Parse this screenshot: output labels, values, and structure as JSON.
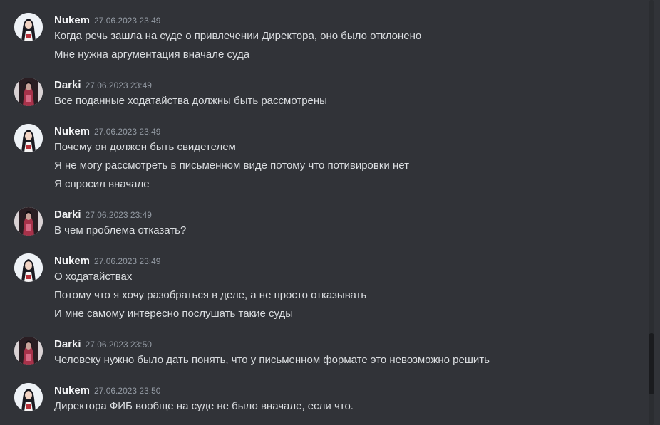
{
  "messages": [
    {
      "author": "Nukem",
      "avatar_icon": "nukem-avatar-icon",
      "time": "27.06.2023 23:49",
      "lines": [
        "Когда речь зашла на суде о привлечении Директора, оно было отклонено",
        "Мне нужна аргументация вначале суда"
      ]
    },
    {
      "author": "Darki",
      "avatar_icon": "darki-avatar-icon",
      "time": "27.06.2023 23:49",
      "lines": [
        "Все поданные ходатайства должны быть рассмотрены"
      ]
    },
    {
      "author": "Nukem",
      "avatar_icon": "nukem-avatar-icon",
      "time": "27.06.2023 23:49",
      "lines": [
        "Почему он должен быть свидетелем",
        "Я не могу рассмотреть в письменном виде потому что потивировки нет",
        "Я спросил вначале"
      ]
    },
    {
      "author": "Darki",
      "avatar_icon": "darki-avatar-icon",
      "time": "27.06.2023 23:49",
      "lines": [
        "В чем проблема отказать?"
      ]
    },
    {
      "author": "Nukem",
      "avatar_icon": "nukem-avatar-icon",
      "time": "27.06.2023 23:49",
      "lines": [
        "О ходатайствах",
        "Потому что я хочу разобраться в деле, а не просто отказывать",
        "И мне самому интересно послушать такие суды"
      ]
    },
    {
      "author": "Darki",
      "avatar_icon": "darki-avatar-icon",
      "time": "27.06.2023 23:50",
      "lines": [
        "Человеку нужно было дать понять, что у письменном формате это невозможно решить"
      ]
    },
    {
      "author": "Nukem",
      "avatar_icon": "nukem-avatar-icon",
      "time": "27.06.2023 23:50",
      "lines": [
        "Директора ФИБ вообще на суде не было вначале, если что."
      ]
    }
  ],
  "colors": {
    "background": "#313338",
    "username": "#f2f3f5",
    "timestamp": "#949ba4",
    "text": "#dbdee1"
  }
}
